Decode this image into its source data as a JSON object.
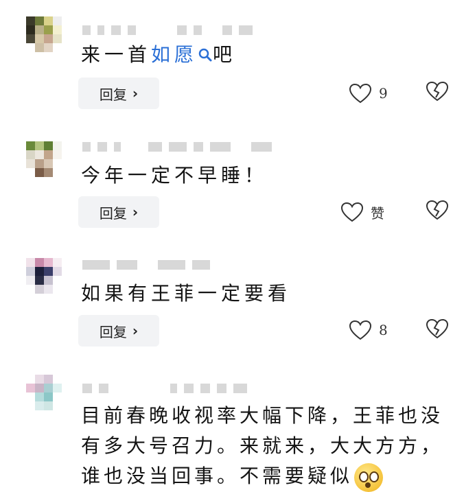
{
  "comments": [
    {
      "text_parts": [
        "来一首",
        "如愿",
        "吧"
      ],
      "reply_label": "回复",
      "like_count": "9"
    },
    {
      "text": "今年一定不早睡！",
      "reply_label": "回复",
      "like_count": "赞"
    },
    {
      "text": "如果有王菲一定要看",
      "reply_label": "回复",
      "like_count": "8"
    },
    {
      "text": "目前春晚收视率大幅下降，王菲也没有多大号召力。来就来，大大方方，谁也没当回事。不需要疑似"
    }
  ],
  "colors": {
    "link": "#2a6fd6",
    "reply_bg": "#f2f3f5"
  }
}
